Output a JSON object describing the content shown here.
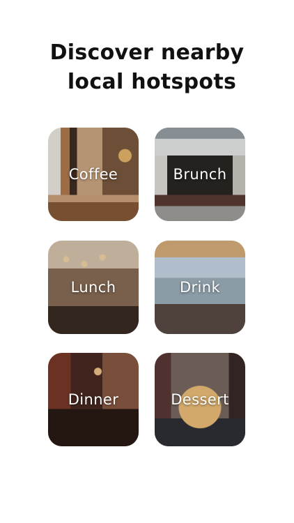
{
  "header": {
    "title_line1": "Discover nearby",
    "title_line2": "local hotspots"
  },
  "categories": [
    {
      "label": "Coffee"
    },
    {
      "label": "Brunch"
    },
    {
      "label": "Lunch"
    },
    {
      "label": "Drink"
    },
    {
      "label": "Dinner"
    },
    {
      "label": "Dessert"
    }
  ]
}
